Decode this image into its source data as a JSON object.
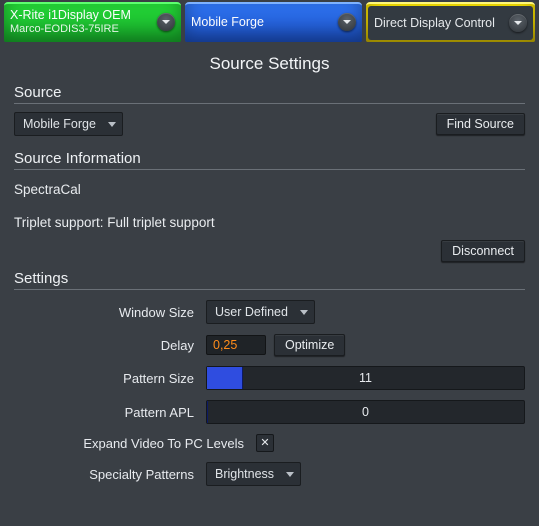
{
  "tabs": [
    {
      "title": "X-Rite i1Display OEM",
      "sub": "Marco-EODIS3-75IRE",
      "style": "green"
    },
    {
      "title": "Mobile Forge",
      "sub": "",
      "style": "blue"
    },
    {
      "title": "Direct Display Control",
      "sub": "",
      "style": "yellow-gray"
    }
  ],
  "page_title": "Source Settings",
  "source": {
    "heading": "Source",
    "selected": "Mobile Forge",
    "find_label": "Find Source"
  },
  "source_info": {
    "heading": "Source Information",
    "vendor": "SpectraCal",
    "triplet_line": "Triplet support: Full triplet support",
    "disconnect_label": "Disconnect"
  },
  "settings": {
    "heading": "Settings",
    "window_size": {
      "label": "Window Size",
      "value": "User Defined"
    },
    "delay": {
      "label": "Delay",
      "value": "0,25",
      "optimize_label": "Optimize"
    },
    "pattern_size": {
      "label": "Pattern Size",
      "value": "11",
      "fill_pct": 11
    },
    "pattern_apl": {
      "label": "Pattern APL",
      "value": "0",
      "fill_pct": 0
    },
    "expand_pc": {
      "label": "Expand Video To PC Levels",
      "checked": true,
      "mark": "✕"
    },
    "specialty": {
      "label": "Specialty Patterns",
      "value": "Brightness"
    }
  }
}
